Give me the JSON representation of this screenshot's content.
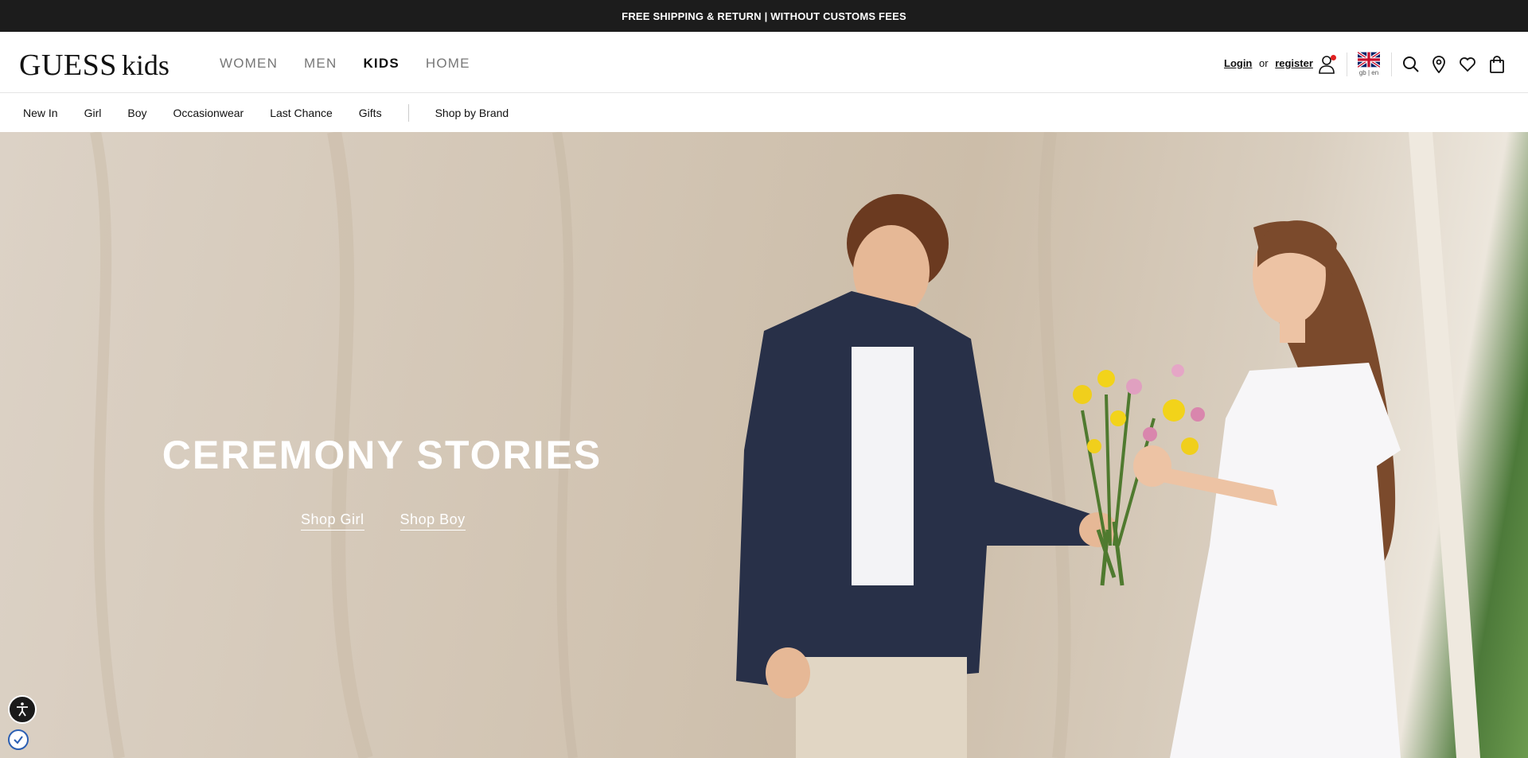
{
  "promo": {
    "text": "FREE SHIPPING & RETURN | WITHOUT CUSTOMS FEES"
  },
  "header": {
    "logo_main": "GUESS",
    "logo_sub": "kids",
    "nav": [
      {
        "label": "WOMEN"
      },
      {
        "label": "MEN"
      },
      {
        "label": "KIDS"
      },
      {
        "label": "HOME"
      }
    ],
    "auth": {
      "login": "Login",
      "or": "or",
      "register": "register"
    },
    "language": "gb | en",
    "icons": [
      "user-icon",
      "flag-icon",
      "search-icon",
      "location-icon",
      "heart-icon",
      "bag-icon"
    ]
  },
  "subnav": {
    "items": [
      {
        "label": "New In"
      },
      {
        "label": "Girl"
      },
      {
        "label": "Boy"
      },
      {
        "label": "Occasionwear"
      },
      {
        "label": "Last Chance"
      },
      {
        "label": "Gifts"
      }
    ],
    "brand_link": "Shop by Brand"
  },
  "hero": {
    "title": "CEREMONY STORIES",
    "links": [
      {
        "label": "Shop Girl"
      },
      {
        "label": "Shop Boy"
      }
    ]
  },
  "colors": {
    "topbar": "#1c1c1c",
    "active_nav": "#111111",
    "inactive_nav": "#777777",
    "notification_dot": "#e02020"
  }
}
